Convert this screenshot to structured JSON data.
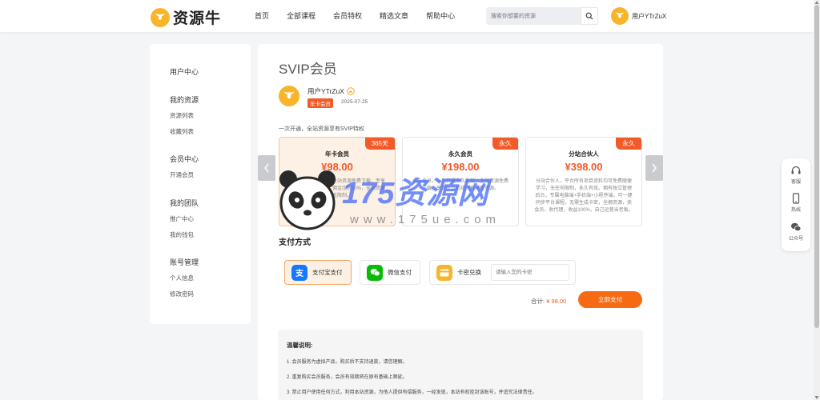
{
  "header": {
    "logo_text": "资源牛",
    "nav": [
      "首页",
      "全部课程",
      "会员特权",
      "精选文章",
      "帮助中心"
    ],
    "search_placeholder": "搜索你想要的资源",
    "username": "用户YTrZuX"
  },
  "sidebar": {
    "user_center": "用户中心",
    "groups": [
      {
        "title": "我的资源",
        "items": [
          "资源列表",
          "收藏列表"
        ]
      },
      {
        "title": "会员中心",
        "items": [
          "开通会员"
        ]
      },
      {
        "title": "我的团队",
        "items": [
          "推广中心",
          "我的钱包"
        ]
      },
      {
        "title": "账号管理",
        "items": [
          "个人信息",
          "修改密码"
        ]
      }
    ]
  },
  "main": {
    "title": "SVIP会员",
    "profile": {
      "name": "用户YTrZuX",
      "badge": "年卡会员",
      "date": "2025-07-25"
    },
    "intro": "一次开通，全站资源享有SVIP特权",
    "plans": [
      {
        "name": "年卡会员",
        "price": "¥98.00",
        "tag": "365天",
        "desc": "年卡会员，有效期内全站资源免费下载，专享客服优先服务，推广佣金比例50%，全站资源下载无限制。"
      },
      {
        "name": "永久会员",
        "price": "¥198.00",
        "tag": "永久",
        "desc": "永久会员，一次开通永久有效，全站资源免费下载，享受平台后续所有更新资源。"
      },
      {
        "name": "分站合伙人",
        "price": "¥398.00",
        "tag": "永久",
        "desc": "分站合伙人，平台所有项目资料均可免费随便学习，无任何限制，永久有效。拥有独立管理后台，专属电脑端+手机端+小程序端，可一键同步平台课程，无需生成卡密，坐拥资源，卖会员，收代理，收益100%，自己运营当老板。"
      }
    ],
    "payment": {
      "title": "支付方式",
      "options": [
        "支付宝支付",
        "微信支付",
        "卡密兑换"
      ],
      "card_placeholder": "请输入您的卡密",
      "total_label": "合计:",
      "total_amount": "¥ 98.00",
      "button": "立即支付"
    },
    "notes": {
      "title": "温馨说明:",
      "items": [
        "1. 会员服务为虚拟产品，购买后不支持退款，请您理解。",
        "2. 重复购买会员服务，会员有效期将在原有基础上顺延。",
        "3. 禁止用户使用任何方式，利用本站资源，为他人提供有偿服务，一经发现，本站有权拒封该账号，并追究法律责任。"
      ]
    }
  },
  "float_panel": {
    "items": [
      "客服",
      "热线",
      "公众号"
    ]
  },
  "watermark": {
    "text": "175资源网",
    "url": "www.175ue.com"
  },
  "colors": {
    "accent": "#f25a28",
    "button": "#f56a12",
    "logo": "#f7b52c",
    "alipay": "#1677ff",
    "wechat": "#09bb07",
    "card": "#f7b52c"
  }
}
